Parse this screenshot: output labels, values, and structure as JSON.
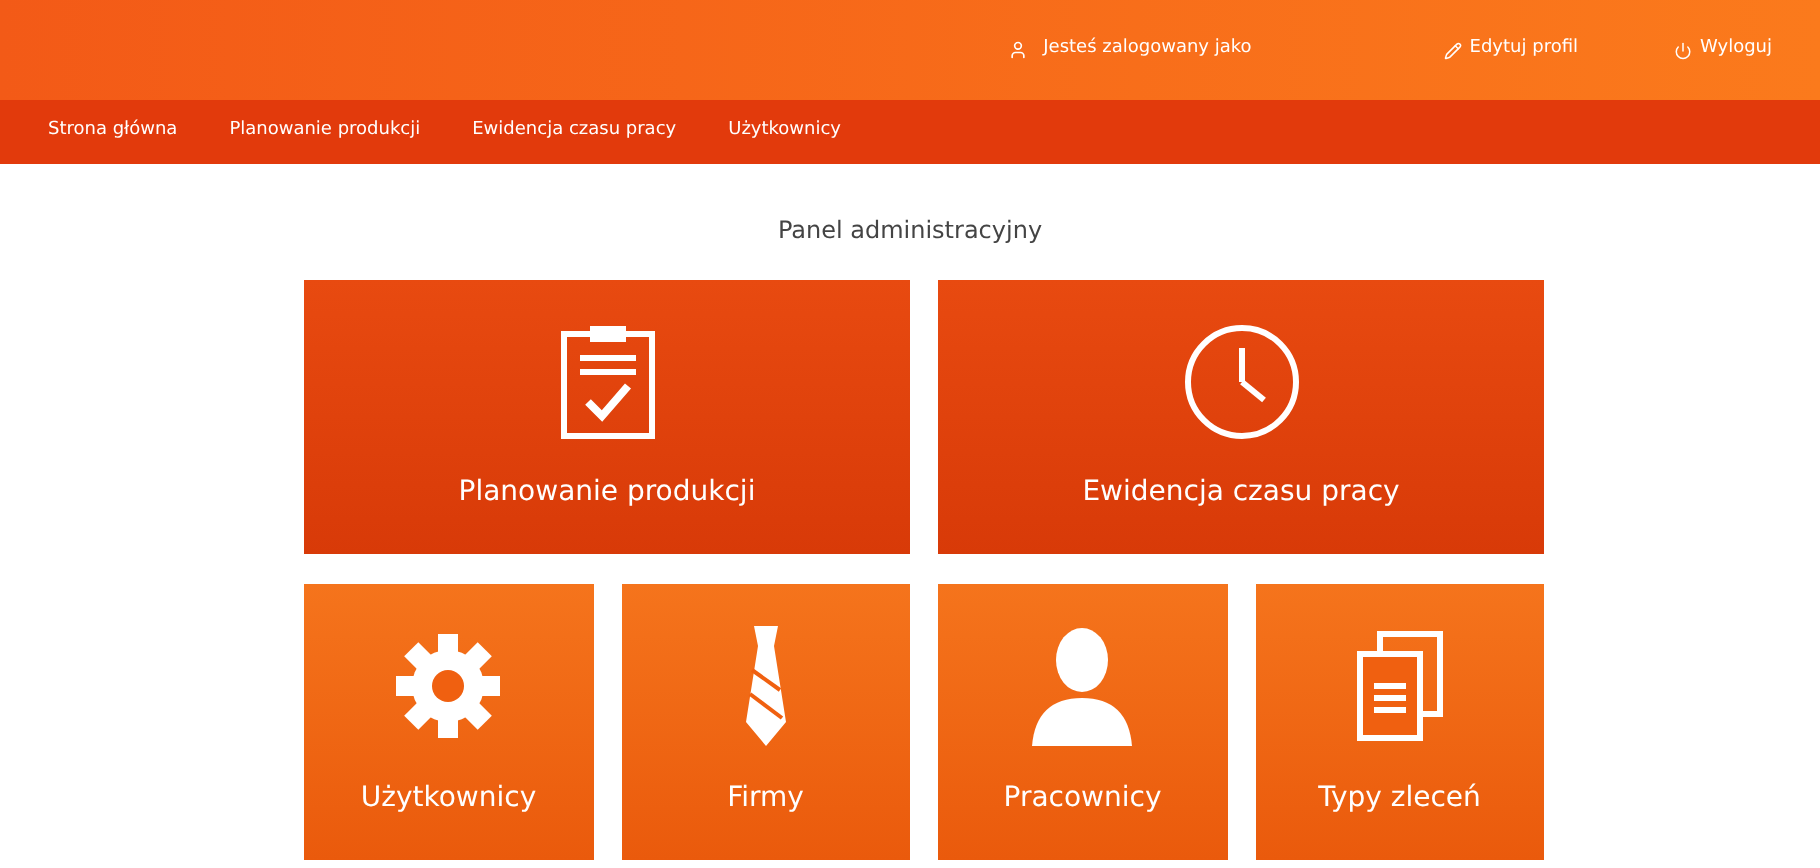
{
  "header": {
    "user": "Jesteś zalogowany jako",
    "edit_profile": "Edytuj profil",
    "logout": "Wyloguj"
  },
  "nav": [
    {
      "label": "Strona główna"
    },
    {
      "label": "Planowanie produkcji"
    },
    {
      "label": "Ewidencja czasu pracy"
    },
    {
      "label": "Użytkownicy"
    }
  ],
  "title": "Panel administracyjny",
  "tiles": [
    {
      "kind": "clipboard",
      "label": "Planowanie produkcji",
      "wide": true
    },
    {
      "kind": "clock",
      "label": "Ewidencja czasu pracy",
      "wide": true
    },
    {
      "kind": "gear",
      "label": "Użytkownicy",
      "wide": false
    },
    {
      "kind": "tie",
      "label": "Firmy",
      "wide": false
    },
    {
      "kind": "person",
      "label": "Pracownicy",
      "wide": false
    },
    {
      "kind": "documents",
      "label": "Typy zleceń",
      "wide": false
    }
  ]
}
